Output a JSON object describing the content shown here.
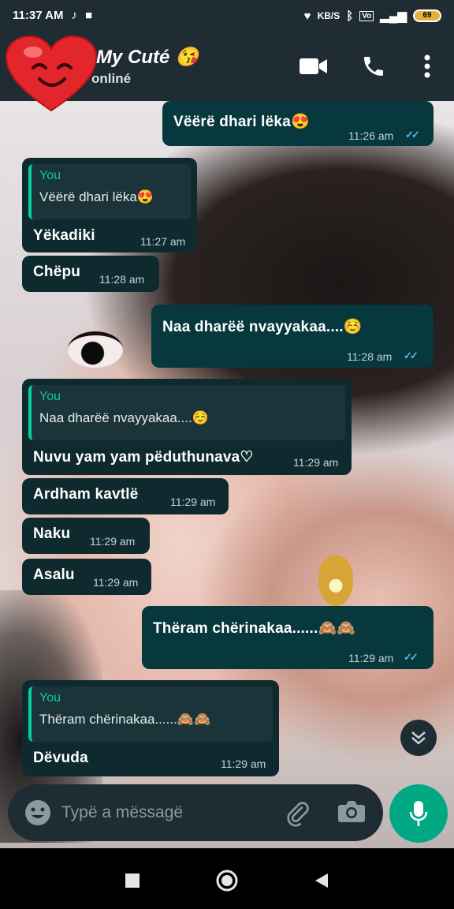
{
  "status_bar": {
    "time": "11:37 AM",
    "net_speed": "KB/S",
    "battery": "69"
  },
  "header": {
    "name": "My Cuté",
    "status": "onliné",
    "name_emoji": "😘"
  },
  "messages": [
    {
      "dir": "out",
      "text": "Vëërë dhari lëka",
      "emoji": "😍",
      "time": "11:26 am"
    },
    {
      "dir": "in",
      "quote_author": "You",
      "quote_text": "Vëërë dhari lëka😍",
      "text": "Yëkadiki",
      "time": "11:27 am"
    },
    {
      "dir": "in",
      "text": "Chëpu",
      "time": "11:28 am"
    },
    {
      "dir": "out",
      "text": "Naa dharëë nvayyakaa....",
      "emoji": "☺️",
      "time": "11:28 am"
    },
    {
      "dir": "in",
      "quote_author": "You",
      "quote_text": "Naa dharëë nvayyakaa....☺️",
      "text": "Nuvu yam yam pëduthunava♡",
      "time": "11:29 am"
    },
    {
      "dir": "in",
      "text": "Ardham kavtlë",
      "time": "11:29 am"
    },
    {
      "dir": "in",
      "text": "Naku",
      "time": "11:29 am"
    },
    {
      "dir": "in",
      "text": "Asalu",
      "time": "11:29 am"
    },
    {
      "dir": "out",
      "text": "Thëram chërinakaa......",
      "emoji": "🙈🙈",
      "time": "11:29 am"
    },
    {
      "dir": "in",
      "quote_author": "You",
      "quote_text": "Thëram chërinakaa......🙈🙈",
      "text": "Dëvuda",
      "time": "11:29 am"
    }
  ],
  "composer": {
    "placeholder": "Typë a mëssagë"
  },
  "colors": {
    "bubble_out": "#07383e",
    "bubble_in": "#0f2a2f",
    "accent": "#00a884",
    "read_ticks": "#53bdeb"
  }
}
